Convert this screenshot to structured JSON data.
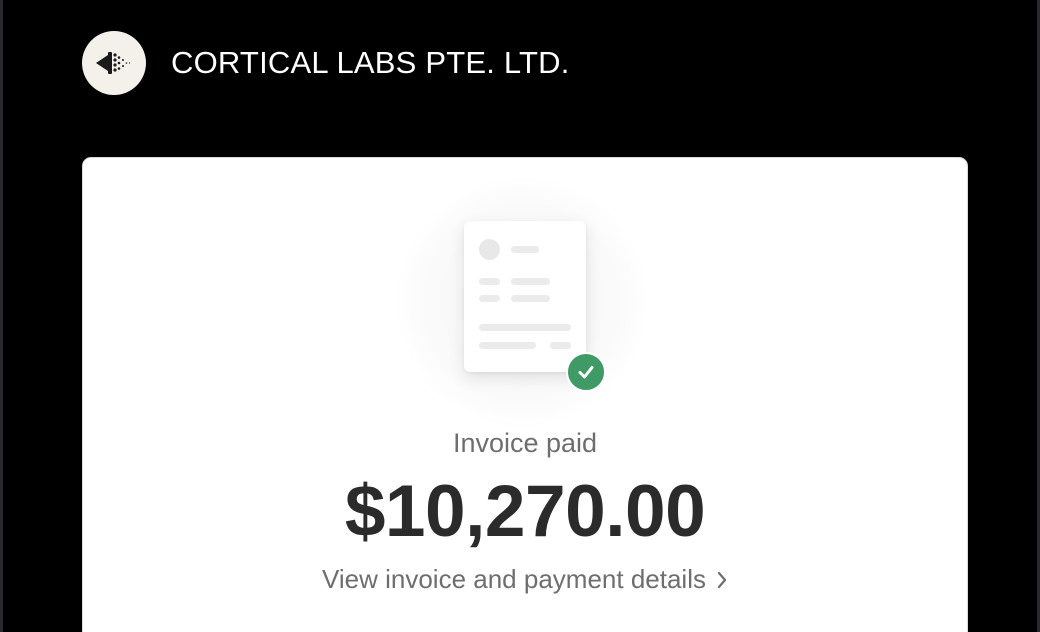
{
  "header": {
    "company_name": "CORTICAL LABS PTE. LTD.",
    "logo_icon": "cortical-labs-logo-icon"
  },
  "card": {
    "illustration_icon": "invoice-document-icon",
    "check_icon": "check-circle-icon",
    "status_text": "Invoice paid",
    "amount": "$10,270.00",
    "details_link": "View invoice and payment details",
    "details_link_icon": "chevron-right-icon"
  },
  "colors": {
    "page_background": "#000000",
    "card_background": "#ffffff",
    "success_green": "#3f9a66",
    "amount_text": "#2b2b2b",
    "muted_text": "#6e6e6e"
  }
}
